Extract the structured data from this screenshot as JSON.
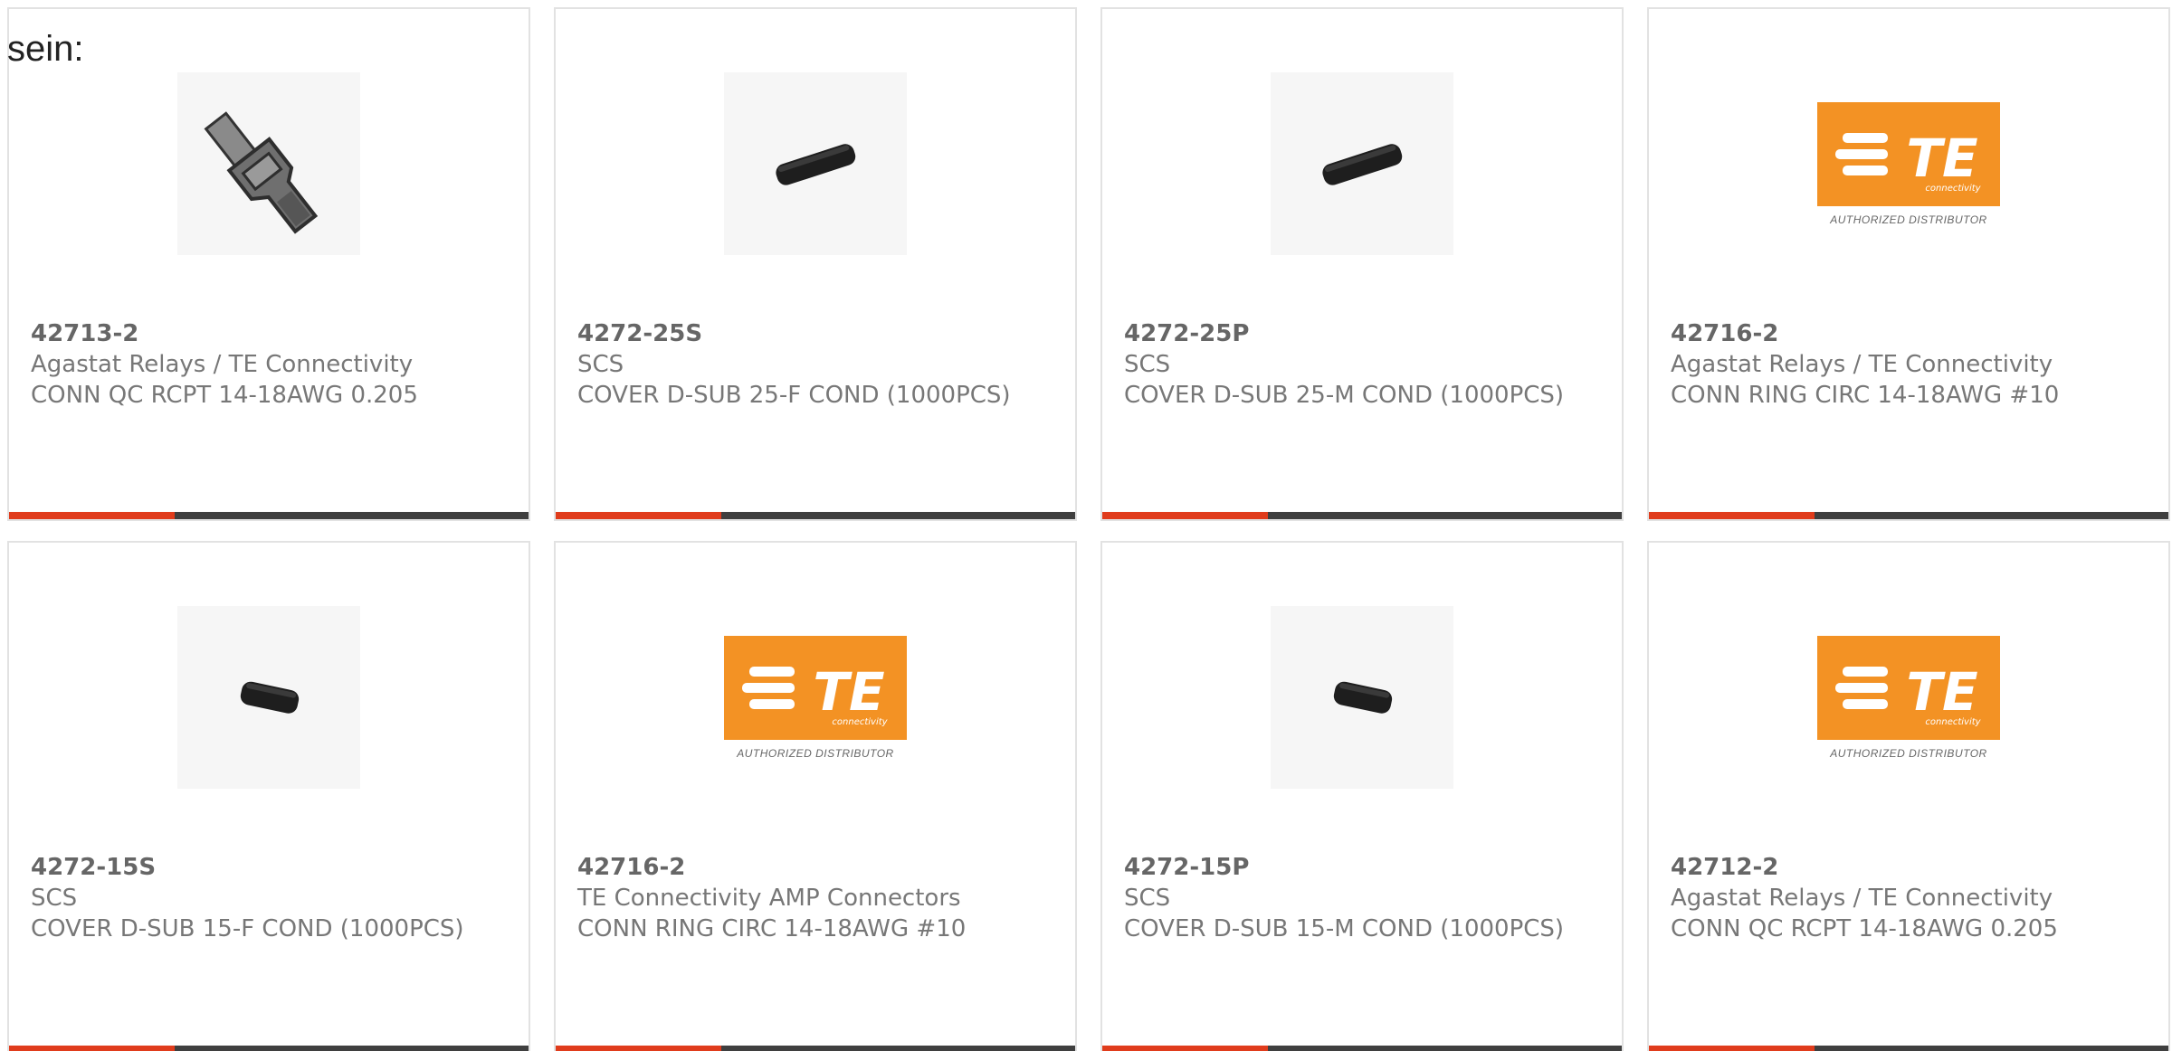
{
  "intro": {
    "text": "sein:"
  },
  "colors": {
    "accent_bar": "#e03c1c",
    "dark_bar": "#3f3f3f",
    "te_orange": "#f39224"
  },
  "logo": {
    "brand": "TE",
    "sub": "connectivity",
    "caption": "AUTHORIZED DISTRIBUTOR"
  },
  "products": [
    {
      "part": "42713-2",
      "manufacturer": "Agastat Relays / TE Connectivity",
      "description": "CONN QC RCPT 14-18AWG 0.205",
      "image": "quick-connect-receptacle"
    },
    {
      "part": "4272-25S",
      "manufacturer": "SCS",
      "description": "COVER D-SUB 25-F COND (1000PCS)",
      "image": "dsub-cover-black"
    },
    {
      "part": "4272-25P",
      "manufacturer": "SCS",
      "description": "COVER D-SUB 25-M COND (1000PCS)",
      "image": "dsub-cover-black"
    },
    {
      "part": "42716-2",
      "manufacturer": "Agastat Relays / TE Connectivity",
      "description": "CONN RING CIRC 14-18AWG #10",
      "image": "te-logo"
    },
    {
      "part": "4272-15S",
      "manufacturer": "SCS",
      "description": "COVER D-SUB 15-F COND (1000PCS)",
      "image": "dsub-cover-small"
    },
    {
      "part": "42716-2",
      "manufacturer": "TE Connectivity AMP Connectors",
      "description": "CONN RING CIRC 14-18AWG #10",
      "image": "te-logo"
    },
    {
      "part": "4272-15P",
      "manufacturer": "SCS",
      "description": "COVER D-SUB 15-M COND (1000PCS)",
      "image": "dsub-cover-small"
    },
    {
      "part": "42712-2",
      "manufacturer": "Agastat Relays / TE Connectivity",
      "description": "CONN QC RCPT 14-18AWG 0.205",
      "image": "te-logo"
    }
  ]
}
